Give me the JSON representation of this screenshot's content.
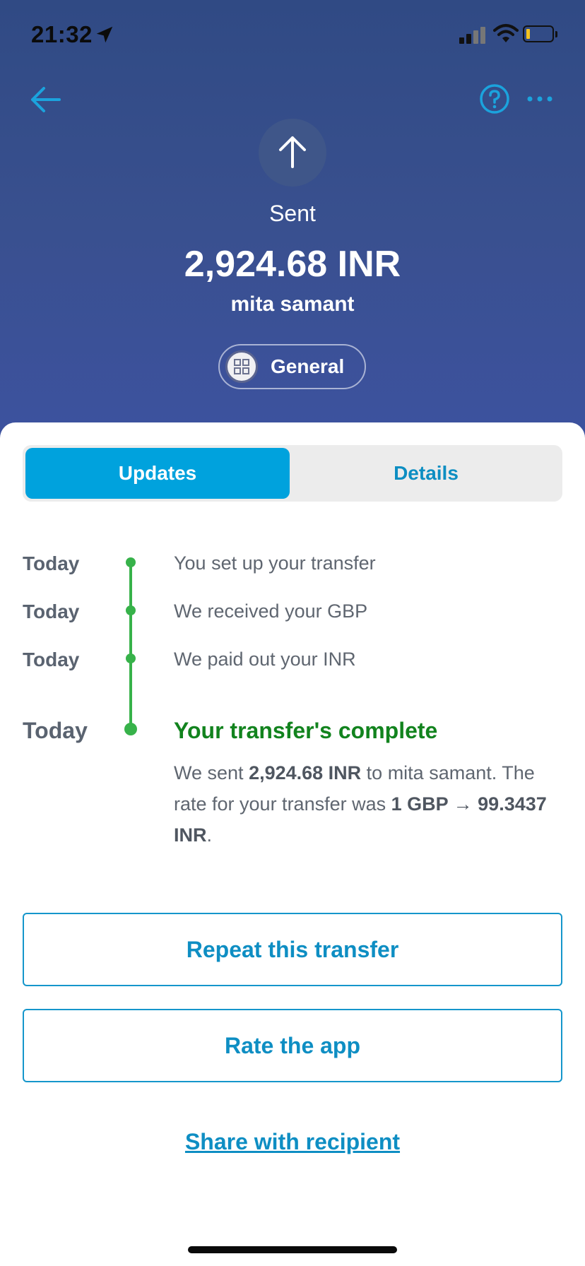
{
  "status_bar": {
    "time": "21:32"
  },
  "header": {
    "direction_label": "Sent",
    "amount": "2,924.68 INR",
    "recipient": "mita samant",
    "category": "General"
  },
  "tabs": [
    {
      "label": "Updates",
      "active": true
    },
    {
      "label": "Details",
      "active": false
    }
  ],
  "timeline": [
    {
      "date": "Today",
      "text": "You set up your transfer"
    },
    {
      "date": "Today",
      "text": "We received your GBP"
    },
    {
      "date": "Today",
      "text": "We paid out your INR"
    },
    {
      "date": "Today",
      "text": "Your transfer's complete"
    }
  ],
  "completion": {
    "sent_prefix": "We sent ",
    "sent_amount": "2,924.68 INR",
    "sent_suffix": " to mita samant.",
    "rate_prefix": "The rate for your transfer was ",
    "rate_value": "1 GBP → 99.3437 INR",
    "rate_suffix": "."
  },
  "actions": {
    "repeat": "Repeat this transfer",
    "rate": "Rate the app",
    "share": "Share with recipient"
  },
  "colors": {
    "header_bg": "#39508f",
    "accent": "#00a2dd",
    "success": "#37b24a",
    "success_text": "#12831e"
  }
}
